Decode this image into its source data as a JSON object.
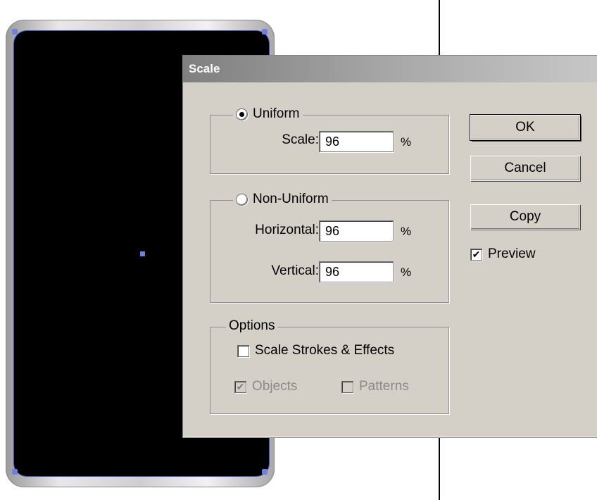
{
  "dialog": {
    "title": "Scale",
    "uniform": {
      "label": "Uniform",
      "selected": true,
      "scale_label": "Scale:",
      "scale_value": "96",
      "unit": "%"
    },
    "non_uniform": {
      "label": "Non-Uniform",
      "selected": false,
      "horizontal_label": "Horizontal:",
      "horizontal_value": "96",
      "horizontal_unit": "%",
      "vertical_label": "Vertical:",
      "vertical_value": "96",
      "vertical_unit": "%"
    },
    "options": {
      "label": "Options",
      "scale_strokes_label": "Scale Strokes & Effects",
      "scale_strokes_checked": false,
      "objects_label": "Objects",
      "objects_checked": true,
      "objects_enabled": false,
      "patterns_label": "Patterns",
      "patterns_checked": false,
      "patterns_enabled": false
    },
    "buttons": {
      "ok": "OK",
      "cancel": "Cancel",
      "copy": "Copy"
    },
    "preview": {
      "label": "Preview",
      "checked": true
    },
    "check_glyph": "✔"
  },
  "colors": {
    "dialog_bg": "#d4d0c8",
    "anchor_point": "#6f7fe0",
    "artwork_fill": "#000000"
  }
}
